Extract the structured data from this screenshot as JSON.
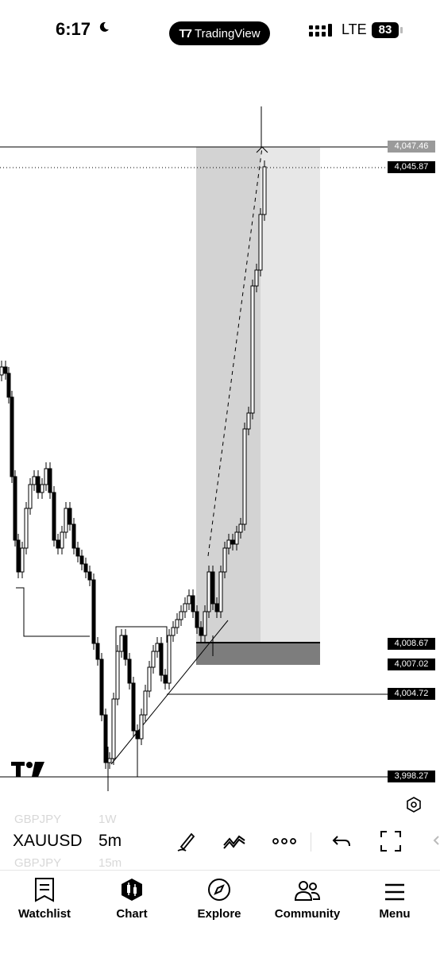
{
  "status_bar": {
    "time": "6:17",
    "app_badge": "TradingView",
    "network": "LTE",
    "battery": "83"
  },
  "chart": {
    "price_labels": [
      {
        "value": "4,047.46",
        "style": "light"
      },
      {
        "value": "4,045.87",
        "style": "dark"
      },
      {
        "value": "4,008.67",
        "style": "dark"
      },
      {
        "value": "4,007.02",
        "style": "dark"
      },
      {
        "value": "4,004.72",
        "style": "dark"
      },
      {
        "value": "3,998.27",
        "style": "dark"
      }
    ]
  },
  "toolbar": {
    "symbol": "XAUUSD",
    "timeframe": "5m",
    "ghost_above": {
      "symbol": "GBPJPY",
      "timeframe": "1W"
    },
    "ghost_below": {
      "symbol": "GBPJPY",
      "timeframe": "15m"
    }
  },
  "tabs": [
    {
      "label": "Watchlist",
      "icon": "watchlist-icon"
    },
    {
      "label": "Chart",
      "icon": "chart-icon"
    },
    {
      "label": "Explore",
      "icon": "compass-icon"
    },
    {
      "label": "Community",
      "icon": "community-icon"
    },
    {
      "label": "Menu",
      "icon": "menu-icon"
    }
  ]
}
